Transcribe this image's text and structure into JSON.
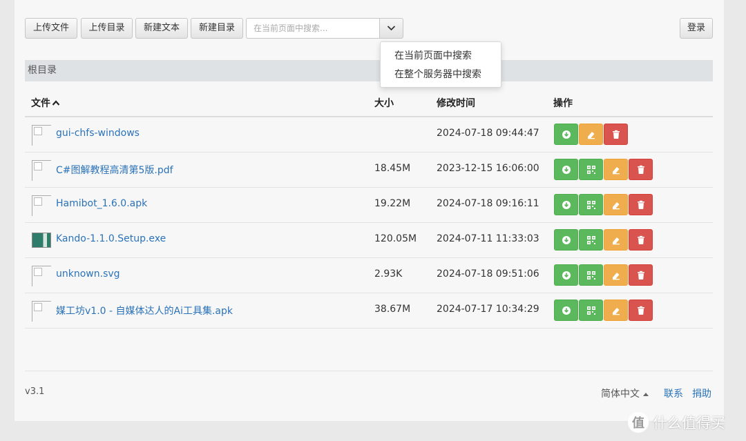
{
  "toolbar": {
    "upload_file": "上传文件",
    "upload_dir": "上传目录",
    "new_text": "新建文本",
    "new_dir": "新建目录",
    "search_placeholder": "在当前页面中搜索...",
    "search_toggle_icon": "chevron-down-icon",
    "login": "登录"
  },
  "search_dropdown": {
    "options": [
      "在当前页面中搜索",
      "在整个服务器中搜索"
    ]
  },
  "breadcrumb": "根目录",
  "table": {
    "headers": {
      "name": "文件",
      "size": "大小",
      "modified": "修改时间",
      "actions": "操作"
    },
    "sort_icon": "chevron-up-icon",
    "rows": [
      {
        "name": "gui-chfs-windows",
        "size": "",
        "modified": "2024-07-18 09:44:47",
        "type": "folder",
        "actions": [
          "download",
          "rename",
          "delete"
        ]
      },
      {
        "name": "C#图解教程高清第5版.pdf",
        "size": "18.45M",
        "modified": "2023-12-15 16:06:00",
        "type": "file",
        "actions": [
          "download",
          "qrcode",
          "rename",
          "delete"
        ]
      },
      {
        "name": "Hamibot_1.6.0.apk",
        "size": "19.22M",
        "modified": "2024-07-18 09:16:11",
        "type": "file",
        "actions": [
          "download",
          "qrcode",
          "rename",
          "delete"
        ]
      },
      {
        "name": "Kando-1.1.0.Setup.exe",
        "size": "120.05M",
        "modified": "2024-07-11 11:33:03",
        "type": "file",
        "actions": [
          "download",
          "qrcode",
          "rename",
          "delete"
        ]
      },
      {
        "name": "unknown.svg",
        "size": "2.93K",
        "modified": "2024-07-18 09:51:06",
        "type": "file",
        "actions": [
          "download",
          "qrcode",
          "rename",
          "delete"
        ]
      },
      {
        "name": "媒工坊v1.0 - 自媒体达人的Ai工具集.apk",
        "size": "38.67M",
        "modified": "2024-07-17 10:34:29",
        "type": "file",
        "actions": [
          "download",
          "qrcode",
          "rename",
          "delete"
        ]
      }
    ]
  },
  "footer": {
    "version": "v3.1",
    "language": "简体中文",
    "contact": "联系",
    "donate": "捐助"
  },
  "watermark": {
    "logo_char": "值",
    "text": "什么值得买"
  },
  "colors": {
    "download": "#5cb85c",
    "qrcode": "#5cb85c",
    "rename": "#f0ad4e",
    "delete": "#d9534f",
    "link": "#2a72b8"
  }
}
